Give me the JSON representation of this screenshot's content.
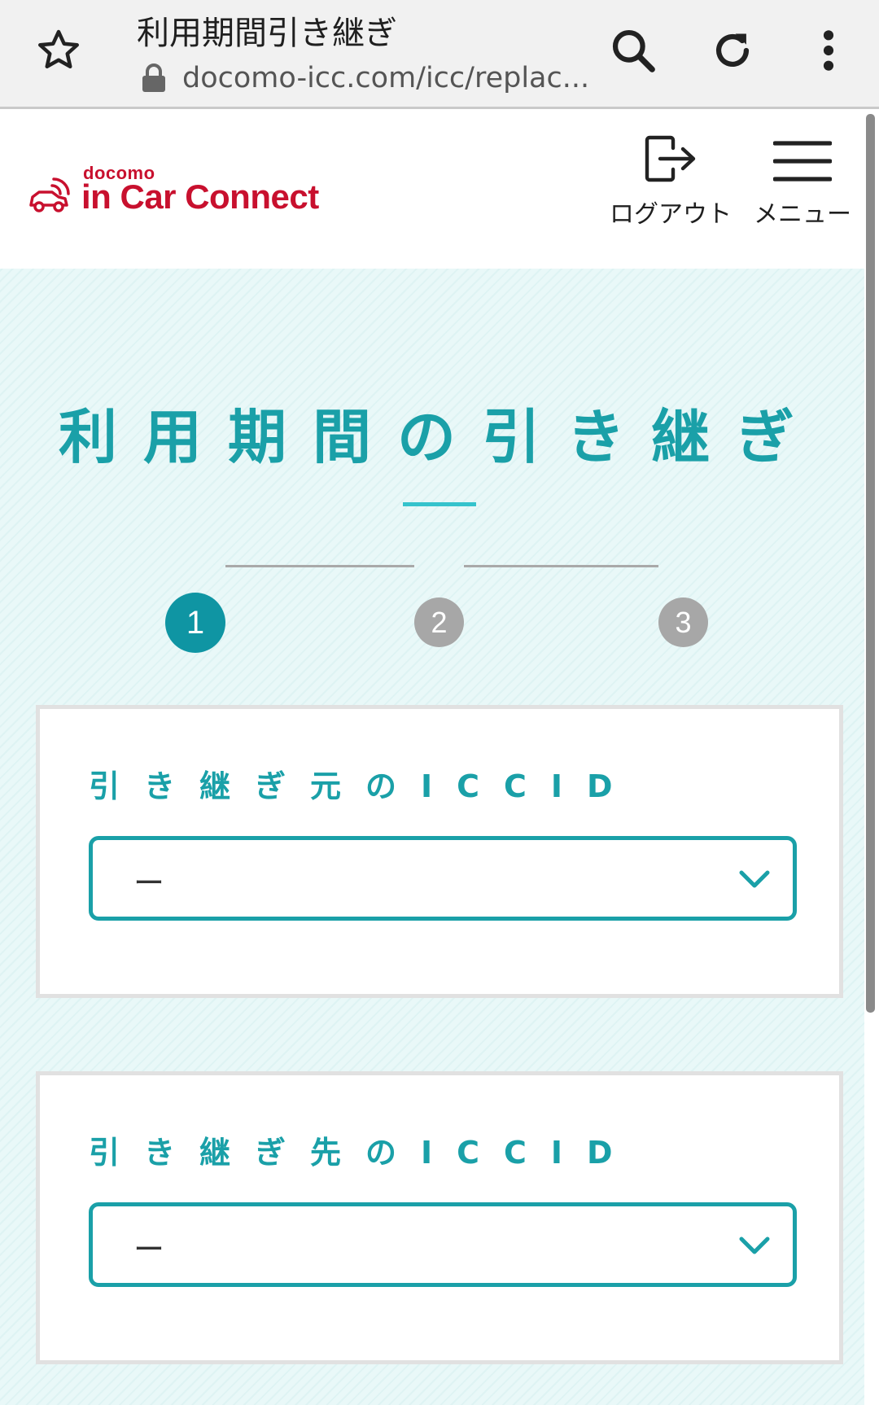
{
  "browser": {
    "tab_title": "利用期間引き継ぎ",
    "url": "docomo-icc.com/icc/replac..."
  },
  "header": {
    "logo_brand": "docomo",
    "logo_product": "in Car Connect",
    "logout_label": "ログアウト",
    "menu_label": "メニュー"
  },
  "main": {
    "title": "利用期間の引き継ぎ",
    "steps": [
      {
        "number": "1",
        "active": true
      },
      {
        "number": "2",
        "active": false
      },
      {
        "number": "3",
        "active": false
      }
    ],
    "source_iccid": {
      "label": "引き継ぎ元のICCID",
      "value": "ー"
    },
    "target_iccid": {
      "label": "引き継ぎ先のICCID",
      "value": "ー"
    }
  },
  "colors": {
    "accent": "#1aa0a8",
    "step_active": "#0f95a3",
    "step_inactive": "#a7a7a7",
    "brand": "#c8102e",
    "background": "#e8f8f8"
  }
}
